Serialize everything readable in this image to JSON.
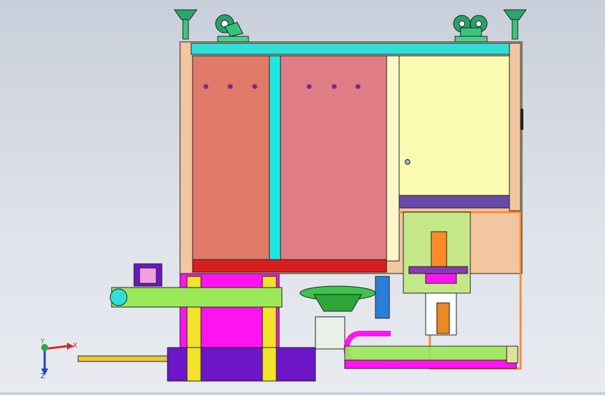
{
  "triad": {
    "x_label": "X",
    "y_label": "Y",
    "z_label": "Z",
    "x_color": "#d8262b",
    "y_color": "#29a83c",
    "z_color": "#2a3fbf"
  },
  "colors": {
    "frame": "#f2c6a0",
    "top_bar": "#2fe0d8",
    "left_door": "#e07a68",
    "right_door": "#e07c84",
    "pillar": "#22e5e0",
    "cabinet": "#fafab0",
    "red_base": "#d81e1e",
    "magenta": "#ff14f0",
    "yellow": "#f2e22a",
    "purple": "#6c16c8",
    "green": "#9be858",
    "orange": "#ff8a2a",
    "olive": "#c4e888"
  }
}
